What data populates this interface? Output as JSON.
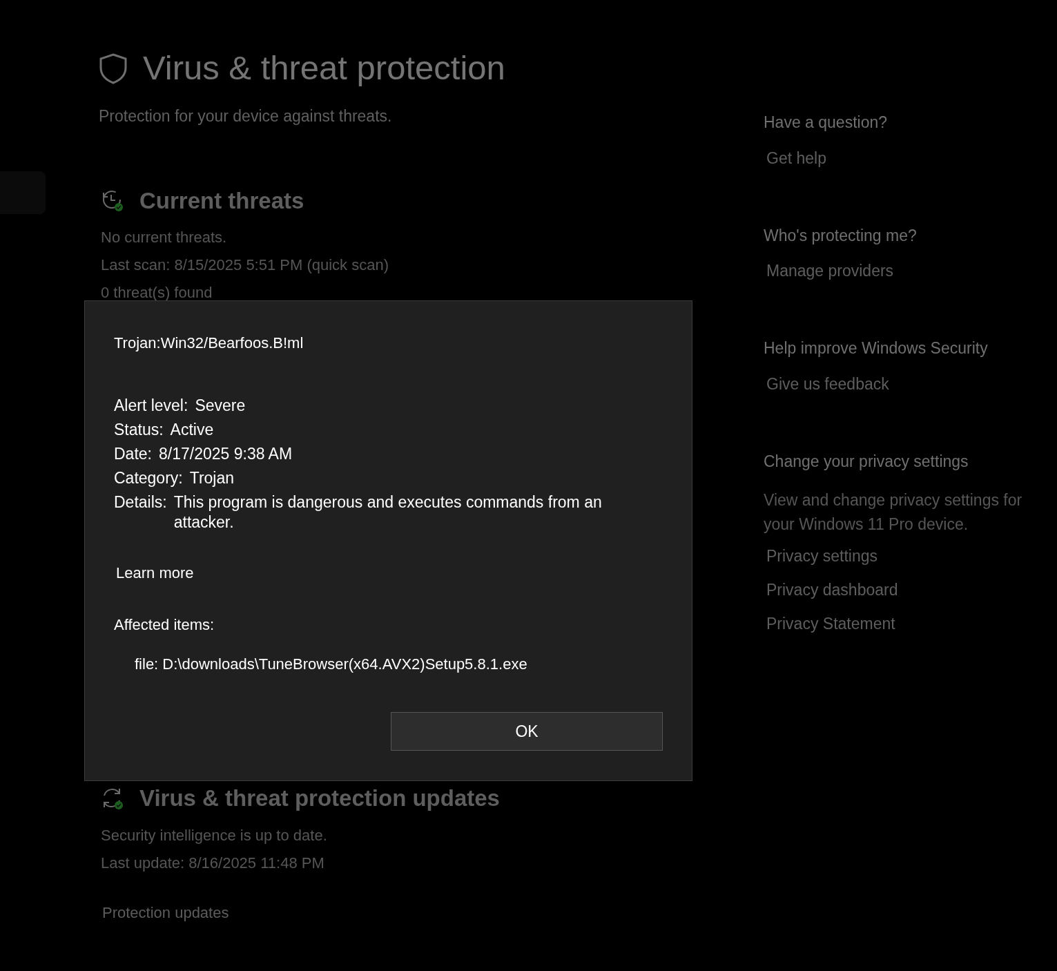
{
  "page": {
    "title": "Virus & threat protection",
    "subtitle": "Protection for your device against threats."
  },
  "sections": [
    {
      "kind": "threats",
      "heading": "Current threats",
      "lines": [
        "No current threats.",
        "Last scan: 8/15/2025 5:51 PM (quick scan)",
        "0 threat(s) found"
      ]
    },
    {
      "kind": "updates",
      "heading": "Virus & threat protection updates",
      "lines": [
        "Security intelligence is up to date.",
        "Last update: 8/16/2025 11:48 PM"
      ],
      "link": "Protection updates"
    }
  ],
  "sidebar": [
    {
      "heading": "Have a question?",
      "links": [
        "Get help"
      ]
    },
    {
      "heading": "Who's protecting me?",
      "links": [
        "Manage providers"
      ]
    },
    {
      "heading": "Help improve Windows Security",
      "links": [
        "Give us feedback"
      ]
    },
    {
      "heading": "Change your privacy settings",
      "text": "View and change privacy settings for your Windows 11 Pro device.",
      "links": [
        "Privacy settings",
        "Privacy dashboard",
        "Privacy Statement"
      ]
    }
  ],
  "dialog": {
    "threat_name": "Trojan:Win32/Bearfoos.B!ml",
    "fields": [
      {
        "label": "Alert level:",
        "value": "Severe"
      },
      {
        "label": "Status:",
        "value": "Active"
      },
      {
        "label": "Date:",
        "value": "8/17/2025 9:38 AM"
      },
      {
        "label": "Category:",
        "value": "Trojan"
      },
      {
        "label": "Details:",
        "value": "This program is dangerous and executes commands from an attacker."
      }
    ],
    "learn_more": "Learn more",
    "affected_label": "Affected items:",
    "affected_item": "file: D:\\downloads\\TuneBrowser(x64.AVX2)Setup5.8.1.exe",
    "ok_button": "OK"
  }
}
